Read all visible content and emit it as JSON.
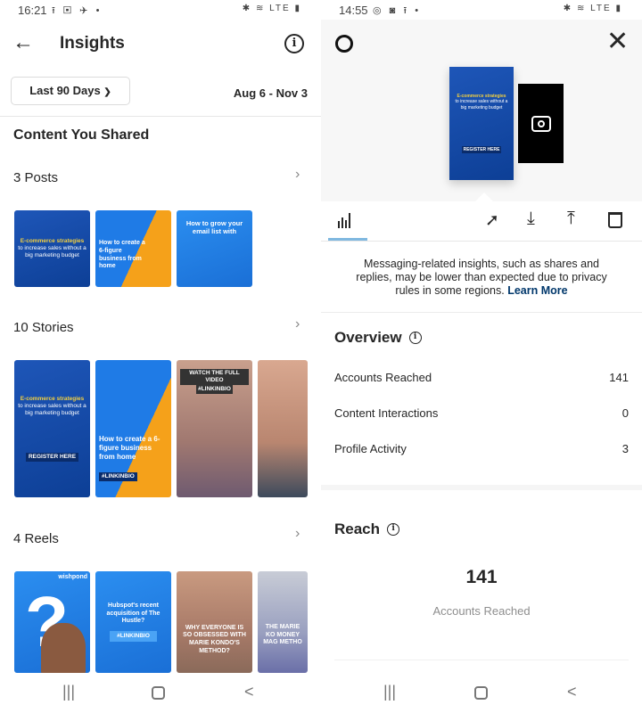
{
  "left": {
    "status": {
      "time": "16:21",
      "icons": "⭱ ▣ ✈ •",
      "right_icons": "✱ ≋ LTE ▮"
    },
    "header": {
      "title": "Insights"
    },
    "filter": {
      "range_label": "Last 90 Days",
      "date_range": "Aug 6 - Nov 3"
    },
    "content_title": "Content You Shared",
    "posts": {
      "label": "3 Posts",
      "thumbs": [
        {
          "headline": "E-commerce strategies",
          "sub": "to increase sales without a big marketing budget"
        },
        {
          "headline": "How to create a 6-figure business from home"
        },
        {
          "headline": "How to grow your email list with"
        }
      ]
    },
    "stories": {
      "label": "10 Stories",
      "thumbs": [
        {
          "headline": "E-commerce strategies",
          "sub": "to increase sales without a big marketing budget",
          "cta": "REGISTER HERE"
        },
        {
          "headline": "How to create a 6-figure business from home",
          "cta": "#LINKINBIO"
        },
        {
          "headline": "WATCH THE FULL VIDEO",
          "cta": "#LINKINBIO"
        },
        {
          "headline": ""
        }
      ]
    },
    "reels": {
      "label": "4 Reels",
      "thumbs": [
        {
          "headline": "?",
          "brand": "wishpond"
        },
        {
          "headline": "Hubspot's recent acquisition of The Hustle?",
          "cta": "#LINKINBIO"
        },
        {
          "headline": "WHY EVERYONE IS SO OBSESSED WITH MARIE KONDO'S METHOD?"
        },
        {
          "headline": "THE MARIE KO MONEY MAG METHO"
        }
      ]
    }
  },
  "right": {
    "status": {
      "time": "14:55",
      "icons": "◎ ◙ ⭱ •",
      "right_icons": "✱ ≋ LTE ▮"
    },
    "preview": {
      "headline": "E-commerce strategies",
      "sub": "to increase sales without a big marketing budget",
      "cta": "REGISTER HERE"
    },
    "notice": {
      "text": "Messaging-related insights, such as shares and replies, may be lower than expected due to privacy rules in some regions.",
      "link": "Learn More"
    },
    "overview": {
      "title": "Overview",
      "rows": [
        {
          "label": "Accounts Reached",
          "value": "141"
        },
        {
          "label": "Content Interactions",
          "value": "0"
        },
        {
          "label": "Profile Activity",
          "value": "3"
        }
      ]
    },
    "reach": {
      "title": "Reach",
      "value": "141",
      "caption": "Accounts Reached"
    }
  },
  "colors": {
    "accent_link": "#00376b",
    "tab_underline": "#7fb8e0",
    "thumb_blue": "#1e56b8",
    "orange": "#f5a11a"
  }
}
